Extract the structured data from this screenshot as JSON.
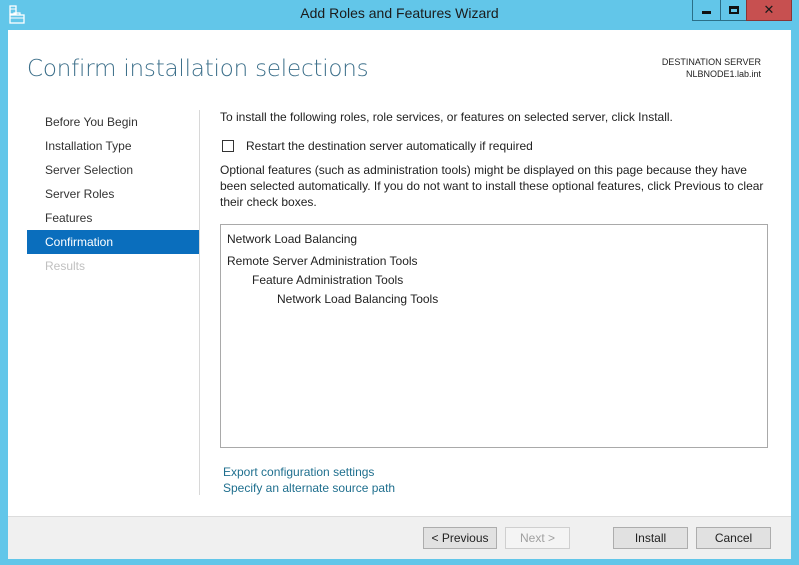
{
  "window": {
    "title": "Add Roles and Features Wizard",
    "controls": {
      "minimize": "minimize",
      "maximize": "maximize",
      "close": "✕"
    },
    "accent_color": "#62c6e9",
    "close_color": "#c75050"
  },
  "header": {
    "page_title": "Confirm installation selections",
    "destination_label": "DESTINATION SERVER",
    "destination_server": "NLBNODE1.lab.int"
  },
  "nav": {
    "items": [
      {
        "label": "Before You Begin",
        "state": "normal"
      },
      {
        "label": "Installation Type",
        "state": "normal"
      },
      {
        "label": "Server Selection",
        "state": "normal"
      },
      {
        "label": "Server Roles",
        "state": "normal"
      },
      {
        "label": "Features",
        "state": "normal"
      },
      {
        "label": "Confirmation",
        "state": "active"
      },
      {
        "label": "Results",
        "state": "disabled"
      }
    ],
    "active_color": "#0a6ebd"
  },
  "content": {
    "intro": "To install the following roles, role services, or features on selected server, click Install.",
    "restart_checkbox": {
      "label": "Restart the destination server automatically if required",
      "checked": false
    },
    "note": "Optional features (such as administration tools) might be displayed on this page because they have been selected automatically. If you do not want to install these optional features, click Previous to clear their check boxes.",
    "selections": [
      {
        "label": "Network Load Balancing",
        "level": 0
      },
      {
        "label": "Remote Server Administration Tools",
        "level": 0
      },
      {
        "label": "Feature Administration Tools",
        "level": 1
      },
      {
        "label": "Network Load Balancing Tools",
        "level": 2
      }
    ],
    "links": {
      "export": "Export configuration settings",
      "alternate_source": "Specify an alternate source path"
    }
  },
  "footer": {
    "previous": "< Previous",
    "next": "Next >",
    "install": "Install",
    "cancel": "Cancel"
  }
}
